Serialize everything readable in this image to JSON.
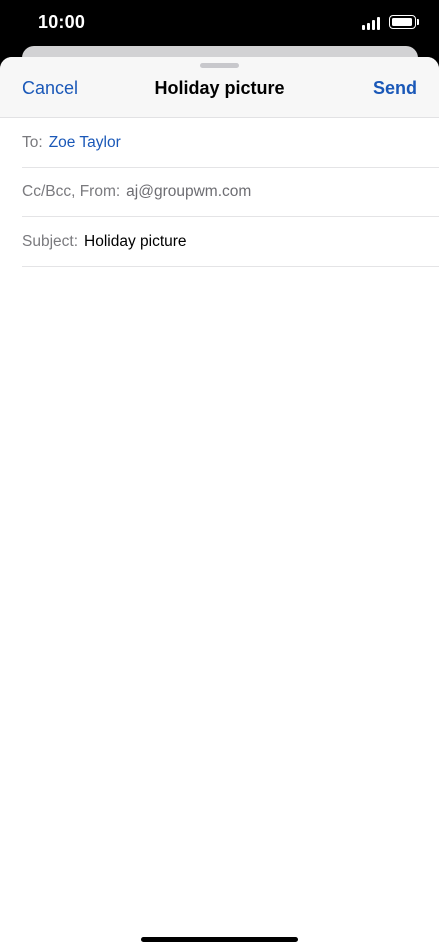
{
  "status_bar": {
    "time": "10:00"
  },
  "compose": {
    "cancel_label": "Cancel",
    "title": "Holiday picture",
    "send_label": "Send",
    "to": {
      "label": "To:",
      "value": "Zoe Taylor"
    },
    "cc_from": {
      "label": "Cc/Bcc, From:",
      "value": "aj@groupwm.com"
    },
    "subject": {
      "label": "Subject:",
      "value": "Holiday picture"
    },
    "body": ""
  },
  "colors": {
    "accent": "#1a58b8",
    "header_bg": "#f7f7f7",
    "divider": "#e4e4e6"
  }
}
